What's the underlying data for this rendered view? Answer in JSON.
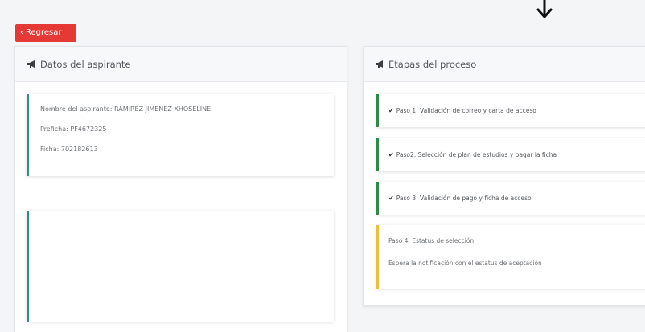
{
  "back_button": {
    "icon": "chevron-left-icon",
    "label": "Regresar",
    "color": "#e53935"
  },
  "applicant_panel": {
    "title": "Datos del aspirante",
    "icon": "megaphone-icon",
    "fields": [
      "Nombre del aspirante: RAMIREZ JIMENEZ XHOSELINE",
      "Preficha: PF4672325",
      "Ficha: 702182613"
    ]
  },
  "process_panel": {
    "title": "Etapas del proceso",
    "icon": "megaphone-icon",
    "steps": [
      {
        "status": "done",
        "label": "Paso 1: Validación de correo y carta de acceso"
      },
      {
        "status": "done",
        "label": "Paso2: Selección de plan de estudios y pagar la ficha"
      },
      {
        "status": "done",
        "label": "Paso 3: Validación de pago y ficha de acceso"
      }
    ],
    "pending_step": {
      "title": "Paso 4: Estatus de selección",
      "message": "Espera la notificación con el estatus de aceptación"
    }
  },
  "colors": {
    "teal_border": "#2e8f8a",
    "green_border": "#2e8a49",
    "yellow_border": "#e6c13a"
  }
}
